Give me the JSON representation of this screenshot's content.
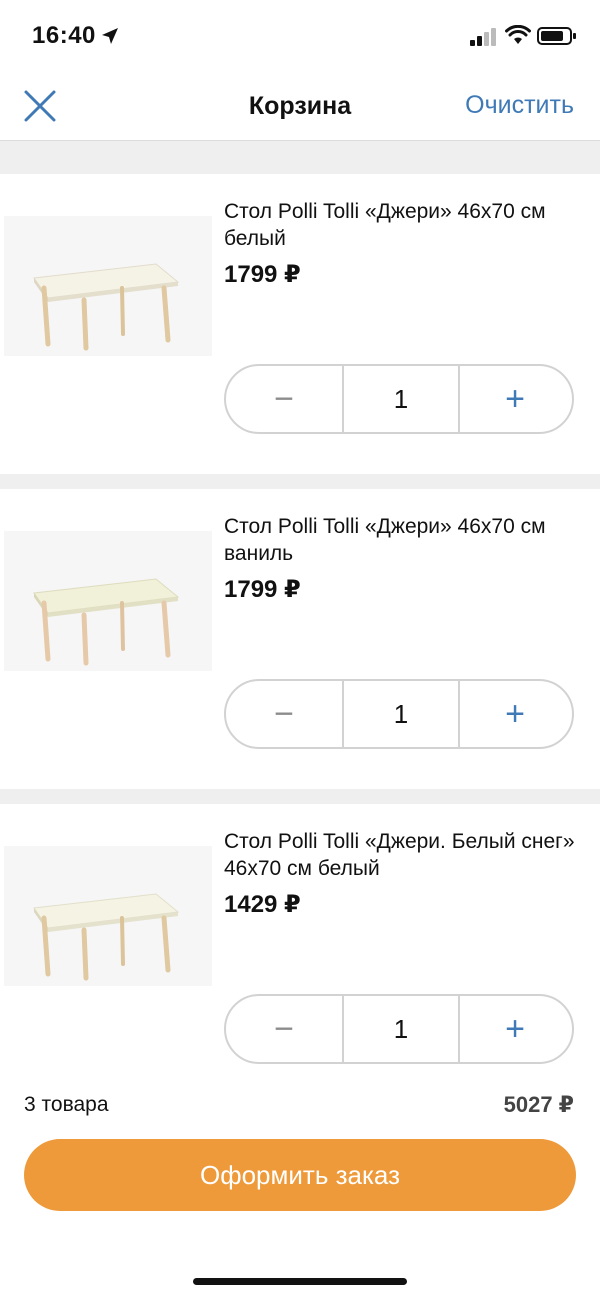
{
  "status": {
    "time": "16:40"
  },
  "nav": {
    "title": "Корзина",
    "clear_label": "Очистить"
  },
  "items": [
    {
      "title": "Стол Polli Tolli  «Джери» 46х70 см белый",
      "price": "1799 ₽",
      "qty": "1",
      "top_color": "#f5f2e6"
    },
    {
      "title": "Стол Polli Tolli  «Джери» 46х70 см ваниль",
      "price": "1799 ₽",
      "qty": "1",
      "top_color": "#f1f0d8"
    },
    {
      "title": "Стол Polli Tolli «Джери. Белый снег» 46х70 см белый",
      "price": "1429 ₽",
      "qty": "1",
      "top_color": "#f5f3e4"
    }
  ],
  "stepper": {
    "minus": "−",
    "plus": "+"
  },
  "footer": {
    "count": "3 товара",
    "total": "5027 ₽",
    "checkout_label": "Оформить заказ"
  },
  "colors": {
    "accent": "#3f7ab6",
    "checkout": "#ee9a3a",
    "separator": "#efefef"
  }
}
